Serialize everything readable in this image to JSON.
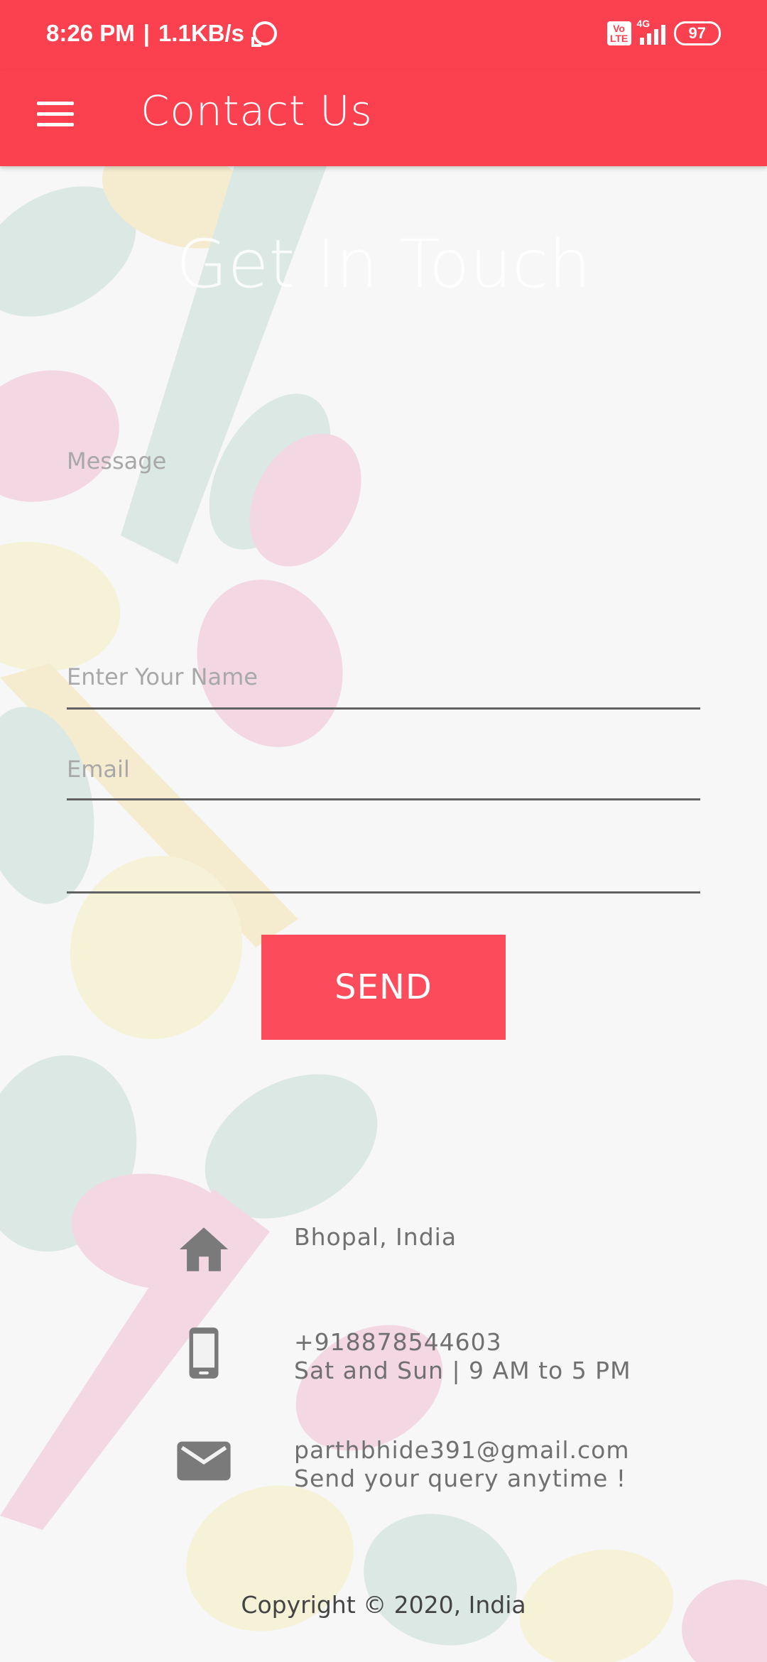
{
  "status": {
    "time": "8:26 PM",
    "speed": "1.1KB/s",
    "volte": "Vo LTE",
    "network": "4G",
    "battery": "97"
  },
  "app_bar": {
    "title": "Contact Us",
    "menu_icon": "hamburger-menu-icon"
  },
  "hero": {
    "heading": "Get In Touch"
  },
  "form": {
    "message_placeholder": "Message",
    "name_placeholder": "Enter Your Name",
    "email_placeholder": "Email",
    "send_label": "SEND"
  },
  "contact": {
    "address": "Bhopal, India",
    "phone": "+918878544603",
    "hours": "Sat and Sun | 9 AM to 5 PM",
    "email": "parthbhide391@gmail.com",
    "email_note": "Send your query anytime !"
  },
  "footer": {
    "copyright": "Copyright © 2020, India"
  },
  "colors": {
    "accent": "#fb4150",
    "button": "#fc4c5b",
    "icon_gray": "#7a7a7a"
  }
}
